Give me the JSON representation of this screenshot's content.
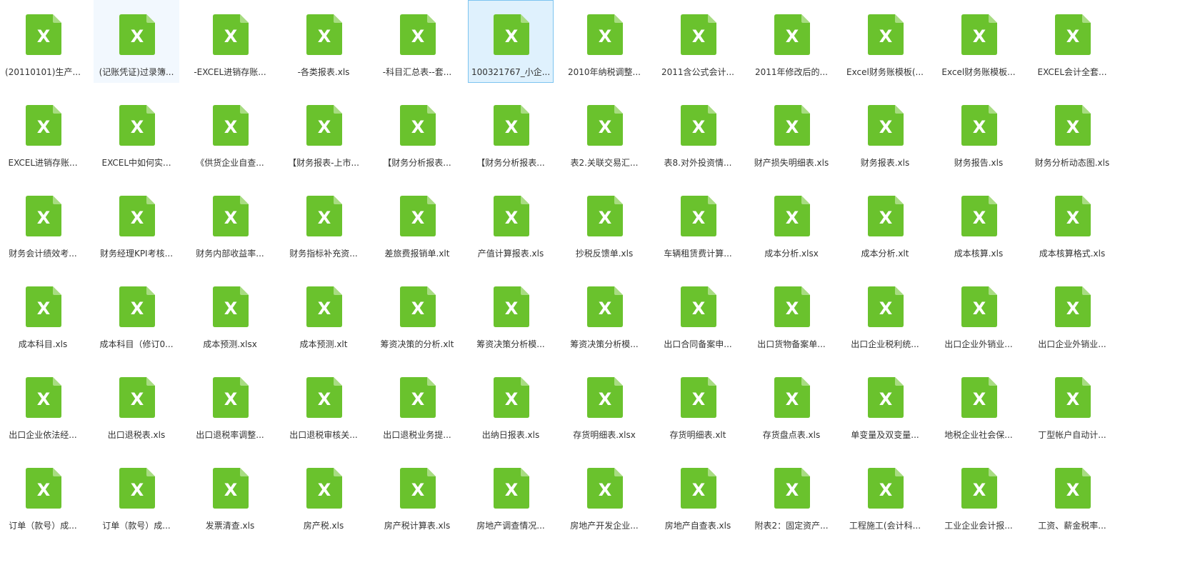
{
  "colors": {
    "icon_green": "#6ac22d",
    "icon_fold": "#a8dc82",
    "icon_letter": "#ffffff",
    "selected_bg": "#dff1fd",
    "selected_border": "#7dc4f0",
    "hover_bg": "#f2f8fe",
    "label_text": "#333333"
  },
  "icon": {
    "name": "excel-file-icon",
    "letter": "X"
  },
  "files": [
    {
      "label": "(20110101)生产..."
    },
    {
      "label": "(记账凭证)过录簿...",
      "state": "hovered"
    },
    {
      "label": "-EXCEL进销存账..."
    },
    {
      "label": "-各类报表.xls"
    },
    {
      "label": "-科目汇总表--套..."
    },
    {
      "label": "100321767_小企...",
      "state": "selected"
    },
    {
      "label": "2010年纳税调整..."
    },
    {
      "label": "2011含公式会计..."
    },
    {
      "label": "2011年修改后的..."
    },
    {
      "label": "Excel财务账模板(..."
    },
    {
      "label": "Excel财务账模板..."
    },
    {
      "label": "EXCEL会计全套..."
    },
    {
      "label": "EXCEL进销存账..."
    },
    {
      "label": "EXCEL中如何实..."
    },
    {
      "label": "《供货企业自查..."
    },
    {
      "label": "【财务报表-上市..."
    },
    {
      "label": "【财务分析报表..."
    },
    {
      "label": "【财务分析报表..."
    },
    {
      "label": "表2.关联交易汇..."
    },
    {
      "label": "表8.对外投资情..."
    },
    {
      "label": "财产损失明细表.xls"
    },
    {
      "label": "财务报表.xls"
    },
    {
      "label": "财务报告.xls"
    },
    {
      "label": "财务分析动态图.xls"
    },
    {
      "label": "财务会计绩效考..."
    },
    {
      "label": "财务经理KPI考核..."
    },
    {
      "label": "财务内部收益率..."
    },
    {
      "label": "财务指标补充资..."
    },
    {
      "label": "差旅费报销单.xlt"
    },
    {
      "label": "产值计算报表.xls"
    },
    {
      "label": "抄税反馈单.xls"
    },
    {
      "label": "车辆租赁费计算..."
    },
    {
      "label": "成本分析.xlsx"
    },
    {
      "label": "成本分析.xlt"
    },
    {
      "label": "成本核算.xls"
    },
    {
      "label": "成本核算格式.xls"
    },
    {
      "label": "成本科目.xls"
    },
    {
      "label": "成本科目（修订0..."
    },
    {
      "label": "成本预测.xlsx"
    },
    {
      "label": "成本预测.xlt"
    },
    {
      "label": "筹资决策的分析.xlt"
    },
    {
      "label": "筹资决策分析模..."
    },
    {
      "label": "筹资决策分析模..."
    },
    {
      "label": "出口合同备案申..."
    },
    {
      "label": "出口货物备案单..."
    },
    {
      "label": "出口企业税利统..."
    },
    {
      "label": "出口企业外销业..."
    },
    {
      "label": "出口企业外销业..."
    },
    {
      "label": "出口企业依法经..."
    },
    {
      "label": "出口退税表.xls"
    },
    {
      "label": "出口退税率调整..."
    },
    {
      "label": "出口退税审核关..."
    },
    {
      "label": "出口退税业务提..."
    },
    {
      "label": "出纳日报表.xls"
    },
    {
      "label": "存货明细表.xlsx"
    },
    {
      "label": "存货明细表.xlt"
    },
    {
      "label": "存货盘点表.xls"
    },
    {
      "label": "单变量及双变量..."
    },
    {
      "label": "地税企业社会保..."
    },
    {
      "label": "丁型帐户自动计..."
    },
    {
      "label": "订单（款号）成..."
    },
    {
      "label": "订单（款号）成..."
    },
    {
      "label": "发票清查.xls"
    },
    {
      "label": "房产税.xls"
    },
    {
      "label": "房产税计算表.xls"
    },
    {
      "label": "房地产调查情况..."
    },
    {
      "label": "房地产开发企业..."
    },
    {
      "label": "房地产自查表.xls"
    },
    {
      "label": "附表2：固定资产..."
    },
    {
      "label": "工程施工(会计科..."
    },
    {
      "label": "工业企业会计报..."
    },
    {
      "label": "工资、薪金税率..."
    }
  ]
}
